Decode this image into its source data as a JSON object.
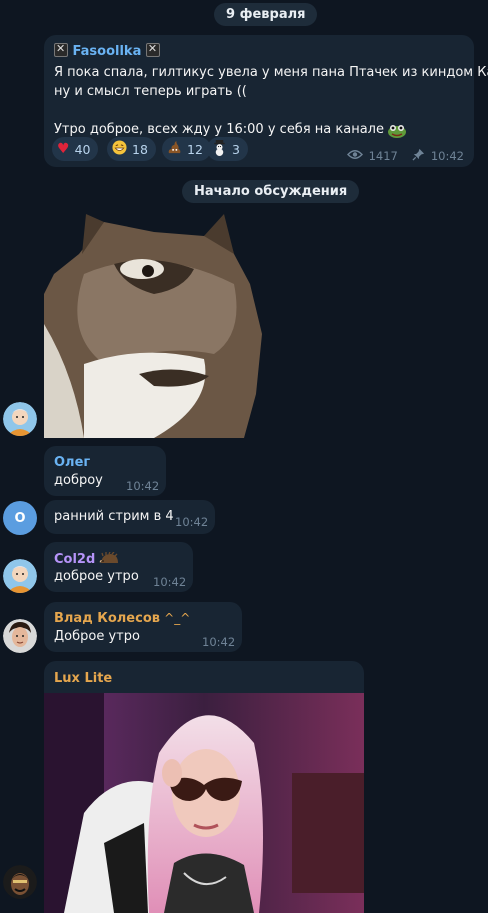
{
  "date_pill": "9 февраля",
  "discussion_pill": "Начало обсуждения",
  "channel_post": {
    "author": "Fasoollka",
    "text_line1": "Я пока спала, гилтикус увела у меня пана Птачек из киндом Кам,",
    "text_line2": "ну и смысл теперь играть ((",
    "text_line3": "Утро доброе, всех жду у 16:00 у себя на канале",
    "reactions": [
      {
        "emoji": "heart",
        "count": "40"
      },
      {
        "emoji": "grin",
        "count": "18"
      },
      {
        "emoji": "poo",
        "count": "12"
      },
      {
        "emoji": "snowman",
        "count": "3"
      }
    ],
    "views": "1417",
    "time": "10:42"
  },
  "messages": [
    {
      "author": "Олег",
      "text": "доброу",
      "time": "10:42"
    },
    {
      "text": "ранний стрим в 4",
      "time": "10:42",
      "avatar_letter": "О"
    },
    {
      "author": "Col2d",
      "text": "доброе утро",
      "time": "10:42"
    },
    {
      "author": "Влад Колесов",
      "author_suffix": "^_^",
      "text": "Доброе утро",
      "time": "10:42"
    },
    {
      "author": "Lux Lite"
    }
  ],
  "colors": {
    "background": "#0e1621",
    "bubble": "#182533",
    "channel_name": "#6ab3f3",
    "oleg_name": "#6ab3f3",
    "col2d_name": "#b694f9",
    "vlad_name": "#e5a64e",
    "lux_name": "#e5a64e"
  }
}
